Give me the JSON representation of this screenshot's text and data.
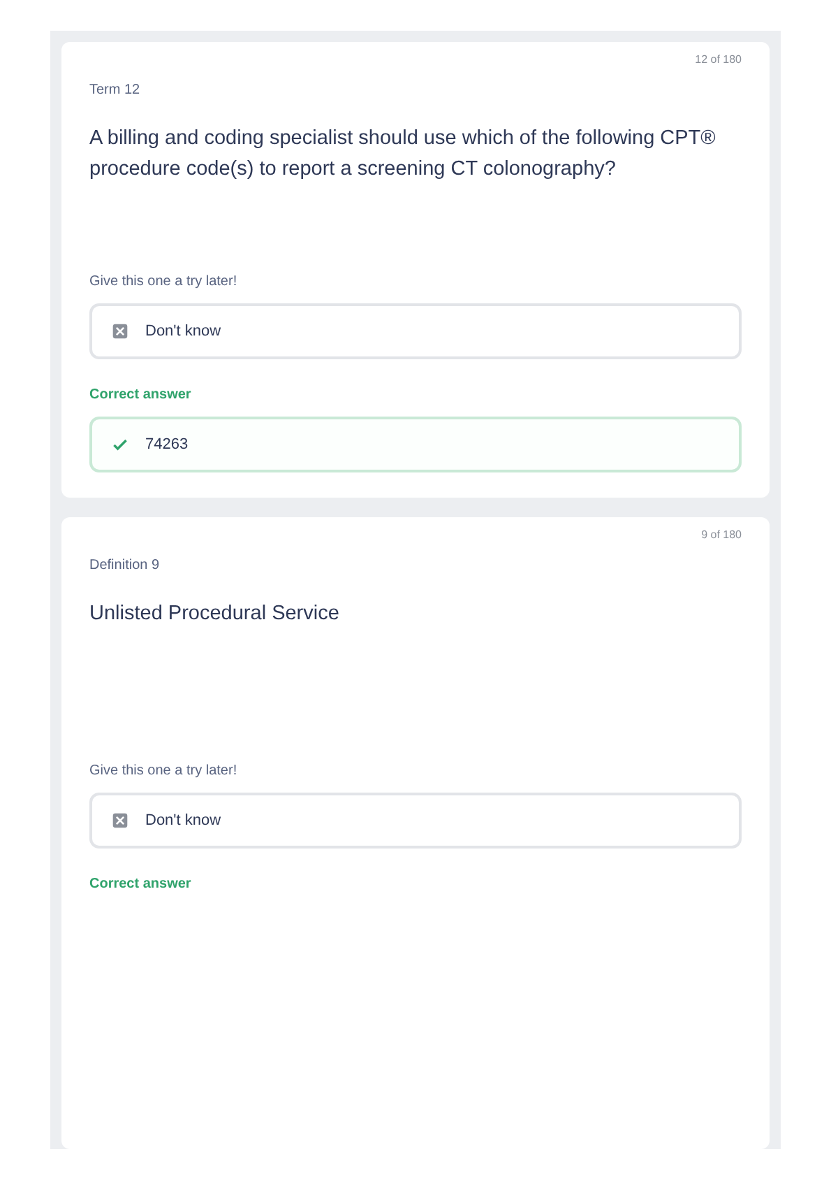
{
  "cards": [
    {
      "counter": "12 of 180",
      "side_label": "Term 12",
      "prompt": "A billing and coding specialist should use which of the following CPT® procedure code(s) to report a screening CT colonography?",
      "question": "Give this one a try later!",
      "response": {
        "kind": "dont_know",
        "text": "Don't know"
      },
      "correct_label": "Correct answer",
      "correct": {
        "kind": "correct",
        "text": "74263"
      }
    },
    {
      "counter": "9 of 180",
      "side_label": "Definition 9",
      "prompt": "Unlisted Procedural Service",
      "question": "Give this one a try later!",
      "response": {
        "kind": "dont_know",
        "text": "Don't know"
      },
      "correct_label": "Correct answer"
    }
  ]
}
